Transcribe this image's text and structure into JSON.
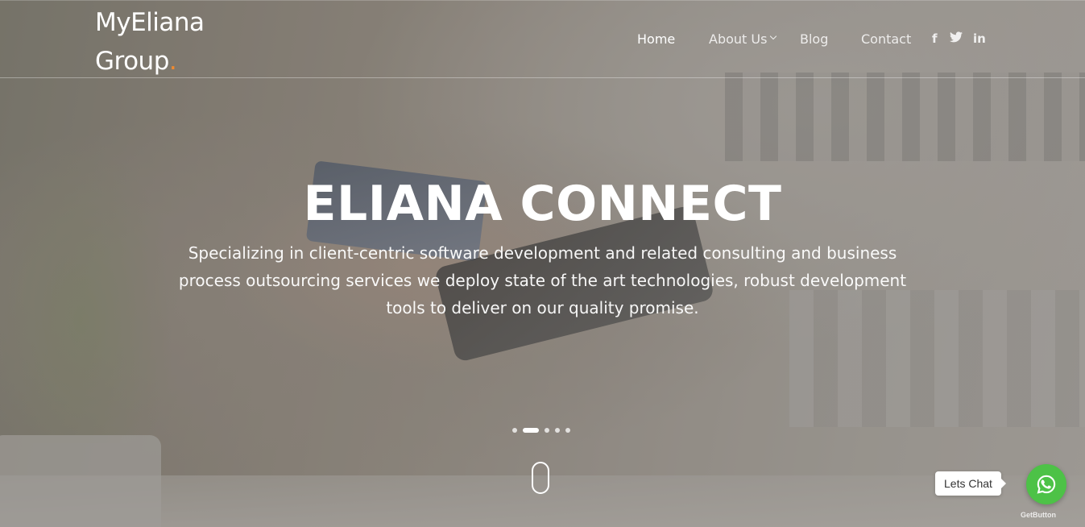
{
  "brand": {
    "line1": "MyEliana",
    "line2": "Group",
    "dot": ".",
    "accent_color": "#f28a2e"
  },
  "nav": {
    "items": [
      {
        "label": "Home",
        "active": true
      },
      {
        "label": "About Us",
        "has_dropdown": true
      },
      {
        "label": "Blog"
      },
      {
        "label": "Contact"
      }
    ]
  },
  "social": {
    "facebook": "f",
    "twitter_icon": "twitter-icon",
    "linkedin": "in"
  },
  "hero": {
    "title": "ELIANA CONNECT",
    "subtitle": "Specializing in client-centric software development and related consulting and business process outsourcing services we deploy state of the art technologies, robust development tools to deliver on our quality promise.",
    "slides_count": 5,
    "active_slide": 2
  },
  "chat": {
    "label": "Lets Chat",
    "button_color": "#4dc247",
    "powered_by": "GetButton"
  }
}
